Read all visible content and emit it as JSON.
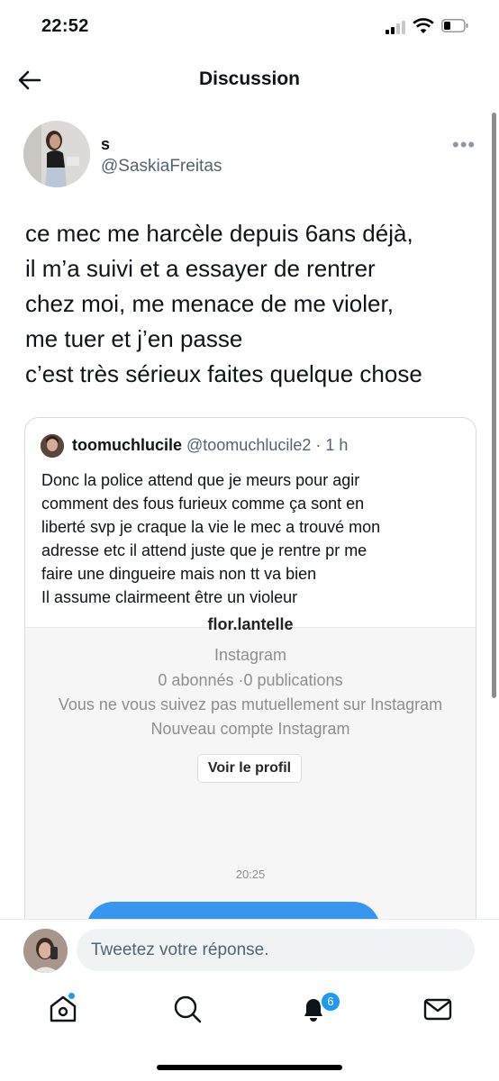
{
  "status_bar": {
    "time": "22:52"
  },
  "header": {
    "title": "Discussion"
  },
  "tweet": {
    "author_name": "s",
    "author_handle": "@SaskiaFreitas",
    "more_label": "•••",
    "text_lines": [
      "ce mec me harcèle depuis 6ans déjà,",
      "il m’a suivi et a essayer de rentrer",
      "chez moi, me menace de me violer,",
      "me tuer et j’en passe",
      "c’est très sérieux faites quelque chose"
    ]
  },
  "quote": {
    "author_name": "toomuchlucile",
    "meta": " @toomuchlucile2 · 1 h",
    "text_lines": [
      "Donc la police attend que je meurs pour agir",
      "comment des fous furieux comme ça sont en",
      "liberté svp je craque la vie le mec a trouvé mon",
      "adresse etc il attend juste que je rentre pr me",
      "faire une dingueire mais non tt va bien",
      "Il assume clairmeent être un violeur"
    ],
    "media": {
      "username_partial": "flor.lantelle",
      "platform": "Instagram",
      "stats": "0 abonnés ·0 publications",
      "mutual": "Vous ne vous suivez pas mutuellement sur Instagram",
      "new_account": "Nouveau compte Instagram",
      "button_label": "Voir le profil",
      "timestamp": "20:25"
    }
  },
  "reply": {
    "placeholder": "Tweetez votre réponse."
  },
  "tab_bar": {
    "items": [
      "home",
      "search",
      "notifications",
      "messages"
    ],
    "notifications_badge": "6"
  },
  "colors": {
    "accent": "#1d9bf0",
    "secondary_text": "#536471"
  }
}
